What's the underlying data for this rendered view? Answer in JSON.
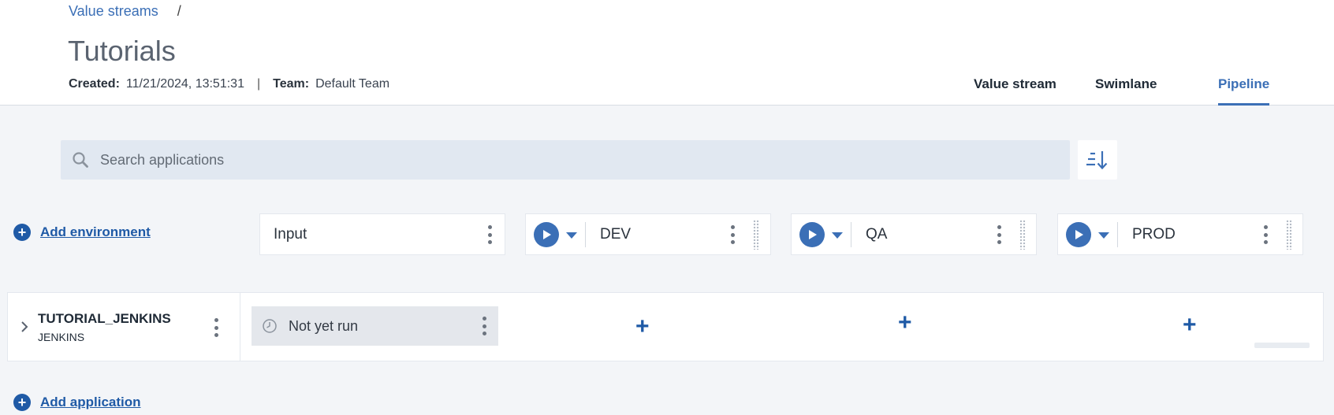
{
  "breadcrumb": {
    "link": "Value streams",
    "separator": "/"
  },
  "page": {
    "title": "Tutorials"
  },
  "meta": {
    "created_label": "Created:",
    "created_value": "11/21/2024, 13:51:31",
    "divider": "|",
    "team_label": "Team:",
    "team_value": "Default Team"
  },
  "tabs": [
    {
      "label": "Value stream",
      "active": false
    },
    {
      "label": "Swimlane",
      "active": false
    },
    {
      "label": "Pipeline",
      "active": true
    }
  ],
  "search": {
    "placeholder": "Search applications",
    "value": ""
  },
  "actions": {
    "add_environment": "Add environment",
    "add_application": "Add application"
  },
  "environments": [
    {
      "name": "Input",
      "has_run": false
    },
    {
      "name": "DEV",
      "has_run": true
    },
    {
      "name": "QA",
      "has_run": true
    },
    {
      "name": "PROD",
      "has_run": true
    }
  ],
  "applications": [
    {
      "name": "TUTORIAL_JENKINS",
      "type": "JENKINS",
      "input_status": "Not yet run"
    }
  ],
  "icons": {
    "search": "search-icon",
    "sort": "sort-descending-icon",
    "play": "play-icon",
    "caret": "caret-down-icon",
    "kebab": "more-vertical-icon",
    "grip": "drag-handle-icon",
    "chevron": "chevron-right-icon",
    "clock": "clock-icon",
    "plus": "plus-icon"
  },
  "colors": {
    "accent": "#3b6fb6",
    "link": "#1f5aa6",
    "background": "#f3f5f8"
  }
}
